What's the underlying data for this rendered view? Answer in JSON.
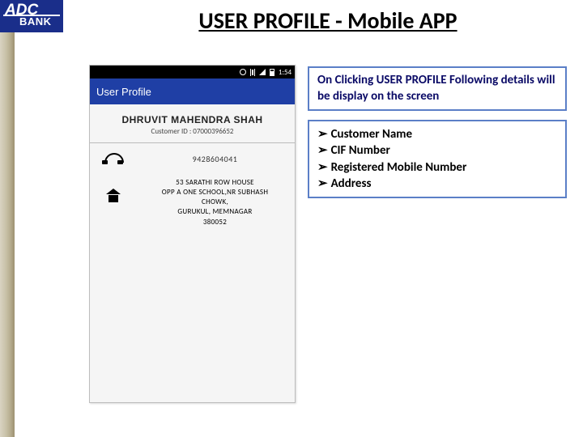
{
  "slide": {
    "title": "USER PROFILE - Mobile APP"
  },
  "logo": {
    "line1": "ADC",
    "line2": "BANK"
  },
  "phone": {
    "status_time": "1:54",
    "appbar_title": "User Profile",
    "customer_name": "DHRUVIT MAHENDRA SHAH",
    "customer_id_label": "Customer ID : 07000396652",
    "mobile_number": "9428604041",
    "address": {
      "l1": "53 SARATHI ROW HOUSE",
      "l2": "OPP A ONE SCHOOL,NR SUBHASH",
      "l3": "CHOWK,",
      "l4": "GURUKUL, MEMNAGAR",
      "l5": "380052"
    }
  },
  "desc": {
    "text": "On Clicking USER PROFILE Following details will be display on the screen",
    "bullets": [
      "Customer Name",
      "CIF Number",
      "Registered Mobile Number",
      "Address"
    ]
  }
}
